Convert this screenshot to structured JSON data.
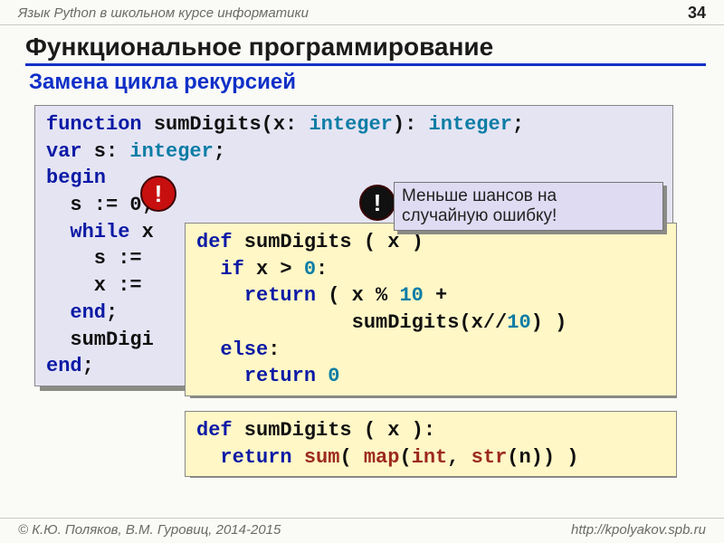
{
  "header": {
    "course": "Язык Python в школьном курсе информатики",
    "page": "34"
  },
  "title": "Функциональное программирование",
  "subtitle": "Замена цикла рекурсией",
  "callout": {
    "line1": "Меньше шансов на",
    "line2": "случайную ошибку!"
  },
  "pascal": {
    "l1a": "function",
    "l1b": " sumDigits(x: ",
    "l1c": "integer",
    "l1d": "): ",
    "l1e": "integer",
    "l1f": ";",
    "l2a": "var",
    "l2b": " s: ",
    "l2c": "integer",
    "l2d": ";",
    "l3": "begin",
    "l4": "  s := 0;",
    "l5a": "  ",
    "l5b": "while",
    "l5c": " x",
    "l6": "    s :=",
    "l7": "    x :=",
    "l8a": "  ",
    "l8b": "end",
    "l8c": ";",
    "l9": "  sumDigi",
    "l10a": "end",
    "l10b": ";"
  },
  "py1": {
    "l1a": "def",
    "l1b": " sumDigits ( x )",
    "l2a": "  ",
    "l2b": "if",
    "l2c": " x > ",
    "l2d": "0",
    "l2e": ":",
    "l3a": "    ",
    "l3b": "return",
    "l3c": " ( x % ",
    "l3d": "10",
    "l3e": " +",
    "l4a": "             sumDigits(x//",
    "l4b": "10",
    "l4c": ") )",
    "l5a": "  ",
    "l5b": "else",
    "l5c": ":",
    "l6a": "    ",
    "l6b": "return",
    "l6c": " ",
    "l6d": "0"
  },
  "py2": {
    "l1a": "def",
    "l1b": " sumDigits ( x ):",
    "l2a": "  ",
    "l2b": "return",
    "l2c": " ",
    "l2d": "sum",
    "l2e": "( ",
    "l2f": "map",
    "l2g": "(",
    "l2h": "int",
    "l2i": ", ",
    "l2j": "str",
    "l2k": "(n)) )"
  },
  "footer": {
    "copyright": "© К.Ю. Поляков, В.М. Гуровиц, 2014-2015",
    "url": "http://kpolyakov.spb.ru"
  }
}
